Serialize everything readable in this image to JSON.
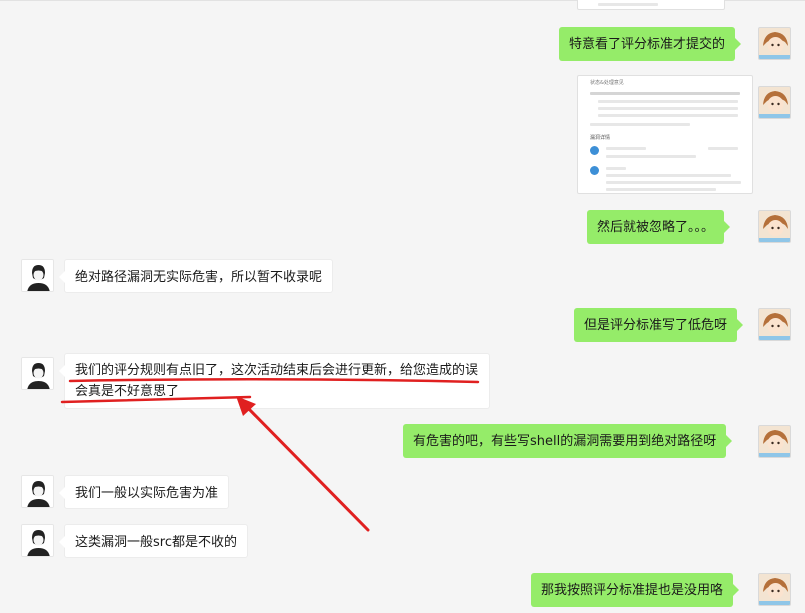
{
  "messages": {
    "m1": "特意看了评分标准才提交的",
    "m2": "然后就被忽略了。。。",
    "m3": "绝对路径漏洞无实际危害，所以暂不收录呢",
    "m4": "但是评分标准写了低危呀",
    "m5": "我们的评分规则有点旧了，这次活动结束后会进行更新，给您造成的误会真是不好意思了",
    "m6": "有危害的吧，有些写shell的漏洞需要用到绝对路径呀",
    "m7": "我们一般以实际危害为准",
    "m8": "这类漏洞一般src都是不收的",
    "m9": "那我按照评分标准提也是没用咯"
  },
  "colors": {
    "self_bubble": "#95ec69",
    "other_bubble": "#ffffff",
    "background": "#f5f5f5",
    "annotation": "#e02020"
  },
  "icons": {
    "other_avatar": "person-silhouette-icon",
    "self_avatar": "anime-girl-avatar-icon"
  }
}
